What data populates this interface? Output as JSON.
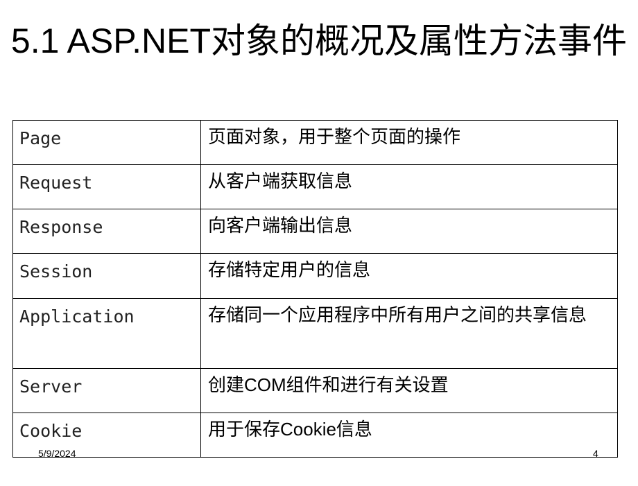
{
  "slide": {
    "title": "5.1 ASP.NET对象的概况及属性方法事件",
    "rows": [
      {
        "name": "Page",
        "desc": "页面对象，用于整个页面的操作"
      },
      {
        "name": "Request",
        "desc": "从客户端获取信息"
      },
      {
        "name": "Response",
        "desc": "向客户端输出信息"
      },
      {
        "name": "Session",
        "desc": "存储特定用户的信息"
      },
      {
        "name": "Application",
        "desc": "存储同一个应用程序中所有用户之间的共享信息"
      },
      {
        "name": "Server",
        "desc": "创建COM组件和进行有关设置"
      },
      {
        "name": "Cookie",
        "desc": "用于保存Cookie信息"
      }
    ],
    "date": "5/9/2024",
    "page_number": "4"
  }
}
